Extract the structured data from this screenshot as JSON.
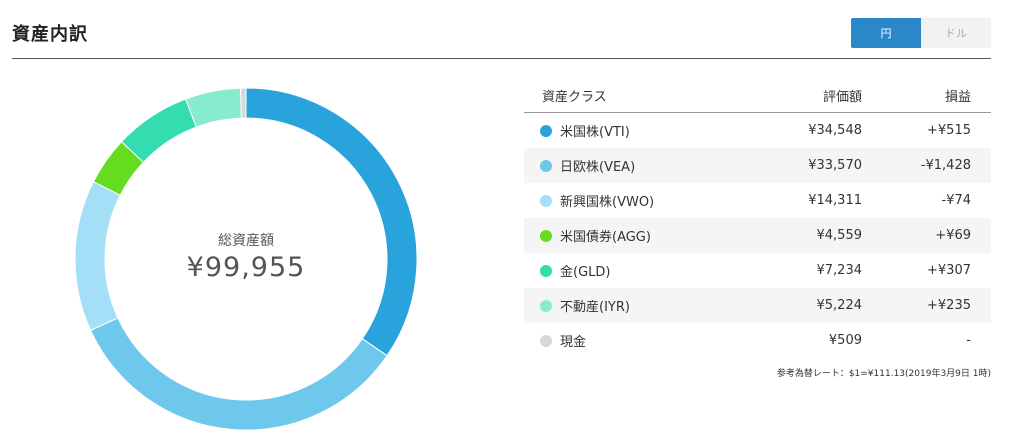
{
  "header": {
    "title": "資産内訳",
    "currency_options": [
      {
        "label": "円",
        "active": true
      },
      {
        "label": "ドル",
        "active": false
      }
    ]
  },
  "summary": {
    "label": "総資産額",
    "value": "¥99,955"
  },
  "table": {
    "columns": [
      "資産クラス",
      "評価額",
      "損益"
    ],
    "rows": [
      {
        "name": "米国株(VTI)",
        "value": "¥34,548",
        "pl": "+¥515",
        "pl_sign": "pos",
        "color": "#29a3dc"
      },
      {
        "name": "日欧株(VEA)",
        "value": "¥33,570",
        "pl": "-¥1,428",
        "pl_sign": "neg",
        "color": "#6ec8ec"
      },
      {
        "name": "新興国株(VWO)",
        "value": "¥14,311",
        "pl": "-¥74",
        "pl_sign": "neg",
        "color": "#a4dff8"
      },
      {
        "name": "米国債券(AGG)",
        "value": "¥4,559",
        "pl": "+¥69",
        "pl_sign": "pos",
        "color": "#66dc1e"
      },
      {
        "name": "金(GLD)",
        "value": "¥7,234",
        "pl": "+¥307",
        "pl_sign": "pos",
        "color": "#33ddb0"
      },
      {
        "name": "不動産(IYR)",
        "value": "¥5,224",
        "pl": "+¥235",
        "pl_sign": "pos",
        "color": "#86ebcf"
      },
      {
        "name": "現金",
        "value": "¥509",
        "pl": "-",
        "pl_sign": "neutral",
        "color": "#d8d8d8"
      }
    ]
  },
  "rate_note": "参考為替レート：$1=¥111.13(2019年3月9日 1時)",
  "chart_data": {
    "type": "pie",
    "donut": true,
    "categories": [
      "米国株(VTI)",
      "日欧株(VEA)",
      "新興国株(VWO)",
      "米国債券(AGG)",
      "金(GLD)",
      "不動産(IYR)",
      "現金"
    ],
    "values": [
      34548,
      33570,
      14311,
      4559,
      7234,
      5224,
      509
    ],
    "colors": [
      "#29a3dc",
      "#6ec8ec",
      "#a4dff8",
      "#66dc1e",
      "#33ddb0",
      "#86ebcf",
      "#d8d8d8"
    ],
    "center_label": "総資産額",
    "center_value": "¥99,955"
  }
}
